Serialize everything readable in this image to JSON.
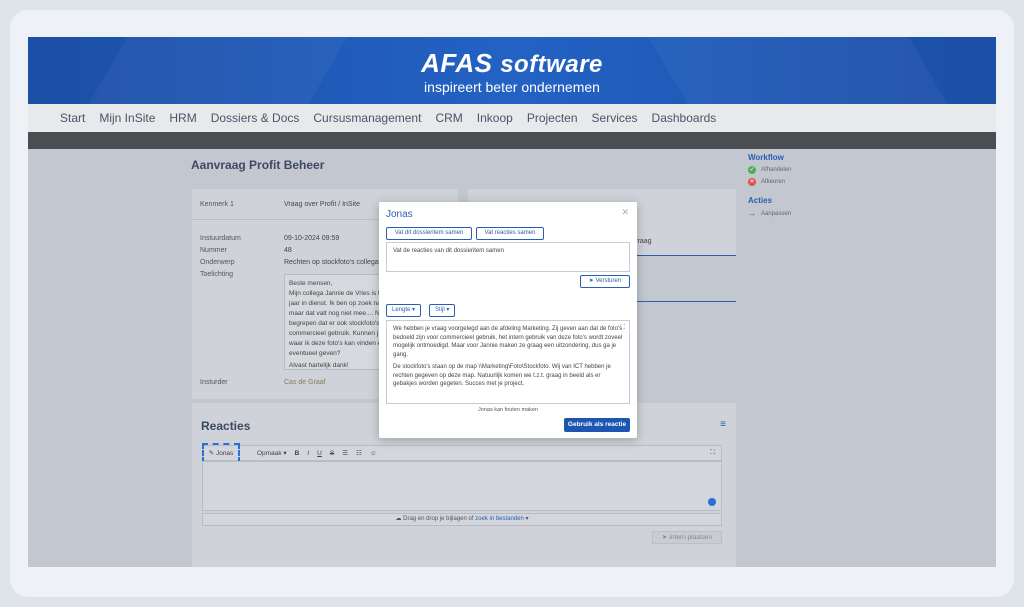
{
  "header": {
    "brand": "AFAS",
    "brand_suffix": "software",
    "tagline": "inspireert beter ondernemen"
  },
  "nav": [
    "Start",
    "Mijn InSite",
    "HRM",
    "Dossiers & Docs",
    "Cursusmanagement",
    "CRM",
    "Inkoop",
    "Projecten",
    "Services",
    "Dashboards"
  ],
  "page": {
    "title": "Aanvraag Profit Beheer"
  },
  "details": {
    "kenmerk_label": "Kenmerk 1",
    "kenmerk_value": "Vraag over Profit / InSite",
    "instuurdatum_label": "Instuurdatum",
    "instuurdatum_value": "09-10-2024 09:59",
    "nummer_label": "Nummer",
    "nummer_value": "48",
    "onderwerp_label": "Onderwerp",
    "onderwerp_value": "Rechten op stockfoto's collega's",
    "toelichting_label": "Toelichting",
    "memo_lines": [
      "Beste mensen,",
      "Mijn collega Jannie de Vries is b",
      "jaar in dienst. Ik ben op zoek na",
      "maar dat valt nog niet mee.... N",
      "begrepen dat er ook stockfoto's",
      "commercieel gebruik. Kunnen j",
      "waar ik deze foto's kan vinden e",
      "eventueel geven?",
      "Alvast hartelijk dank!"
    ],
    "insturder_label": "Insturder",
    "insturder_value": "Cas de Graaf"
  },
  "card2": {
    "label": "vraag"
  },
  "sidebar": {
    "workflow_title": "Workflow",
    "workflow_items": [
      "Afhandelen",
      "Afkeuren"
    ],
    "acties_title": "Acties",
    "acties_items": [
      "Aanpassen"
    ]
  },
  "reacties": {
    "title": "Reacties",
    "jonas_button": "Jonas",
    "opmaak": "Opmaak",
    "dropzone_text": "Drag en drop je bijlagen of",
    "dropzone_link": "zoek in bestanden",
    "place_button": "Intern plaatsen"
  },
  "modal": {
    "title": "Jonas",
    "btn_item": "Vat dit dossieritem samen",
    "btn_reacties": "Vat reacties samen",
    "prompt_text": "Vat de reacties van dit dossieritem samen",
    "send": "Versturen",
    "lengte": "Lengte",
    "stijl": "Stijl",
    "answer_p1": "We hebben je vraag voorgelegd aan de afdeling Marketing. Zij geven aan dat de foto's bedoeld zijn voor commercieel gebruik, het intern gebruik van deze foto's wordt zoveel mogelijk ontmoedigd. Maar voor Jannie maken ze graag een uitzondering, dus ga je gang.",
    "answer_p2": "De stockfoto's staan op de map \\\\Marketing\\Foto\\Stockfoto. Wij van ICT hebben je rechten gegeven op deze map. Natuurlijk komen we t.z.t. graag in beeld als er gebakjes worden gegeten. Succes met je project.",
    "disclaimer": "Jonas kan fouten maken",
    "use_button": "Gebruik als reactie"
  },
  "colors": {
    "brand_blue": "#1d56b0",
    "accent": "#2a6fd6"
  }
}
